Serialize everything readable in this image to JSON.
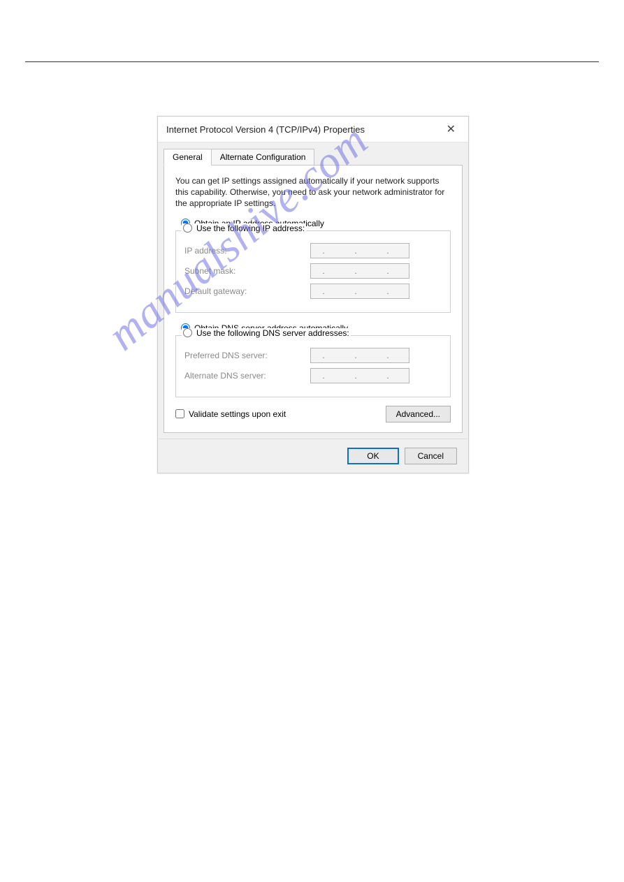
{
  "watermark": "manualshive.com",
  "dialog": {
    "title": "Internet Protocol Version 4 (TCP/IPv4) Properties",
    "close_symbol": "✕",
    "tabs": {
      "general": "General",
      "alt": "Alternate Configuration"
    },
    "description": "You can get IP settings assigned automatically if your network supports this capability. Otherwise, you need to ask your network administrator for the appropriate IP settings.",
    "ip": {
      "auto_label": "Obtain an IP address automatically",
      "manual_label": "Use the following IP address:",
      "fields": {
        "ip_address": "IP address:",
        "subnet": "Subnet mask:",
        "gateway": "Default gateway:"
      }
    },
    "dns": {
      "auto_label": "Obtain DNS server address automatically",
      "manual_label": "Use the following DNS server addresses:",
      "fields": {
        "preferred": "Preferred DNS server:",
        "alternate": "Alternate DNS server:"
      }
    },
    "ip_placeholder": ".  .  .",
    "validate_label": "Validate settings upon exit",
    "advanced_label": "Advanced...",
    "ok_label": "OK",
    "cancel_label": "Cancel"
  }
}
